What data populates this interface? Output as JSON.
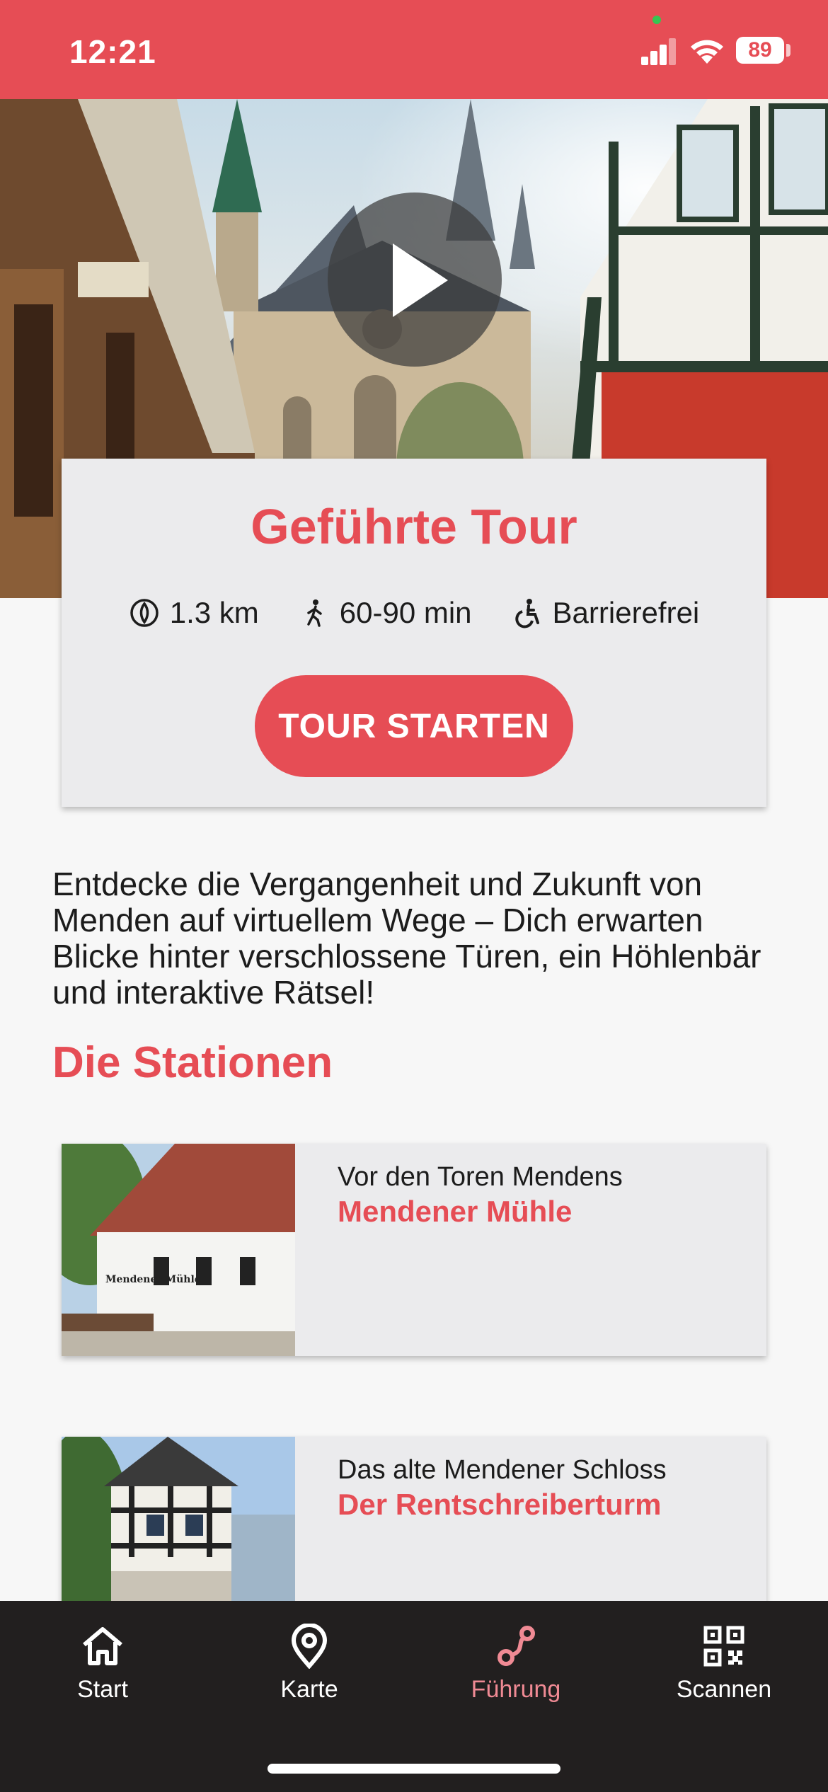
{
  "status_bar": {
    "time": "12:21",
    "battery": "89"
  },
  "hero": {
    "play_icon": "play-icon"
  },
  "tour": {
    "title": "Geführte Tour",
    "distance": "1.3 km",
    "duration": "60-90 min",
    "accessibility": "Barrierefrei",
    "start_label": "TOUR STARTEN"
  },
  "description": "Entdecke die Vergangenheit und Zukunft von Menden auf virtuellem Wege – Dich erwarten Blicke hinter verschlossene Türen, ein Höhlenbär und interaktive Rätsel!",
  "stations": {
    "title": "Die Stationen",
    "items": [
      {
        "subtitle": "Vor den Toren Mendens",
        "name": "Mendener Mühle",
        "sign_text": "Mendener Mühle"
      },
      {
        "subtitle": "Das alte Mendener Schloss",
        "name": "Der Rentschreiberturm"
      }
    ]
  },
  "tabbar": {
    "items": [
      {
        "label": "Start",
        "icon": "home-icon"
      },
      {
        "label": "Karte",
        "icon": "map-pin-icon"
      },
      {
        "label": "Führung",
        "icon": "route-icon",
        "active": true
      },
      {
        "label": "Scannen",
        "icon": "qr-code-icon"
      }
    ]
  },
  "colors": {
    "accent": "#e64d55",
    "tabbar_bg": "#221f1f",
    "active_tab": "#f08a94"
  }
}
